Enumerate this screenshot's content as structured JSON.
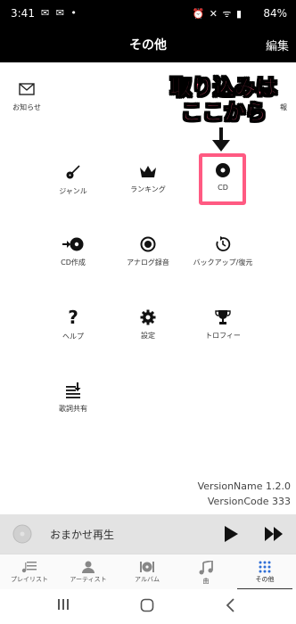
{
  "status": {
    "time": "3:41",
    "left_icons": "✉ ✉ •",
    "right_icons": "⏰ ✕ ᯤ ▮",
    "battery": "84%"
  },
  "header": {
    "title": "その他",
    "edit_label": "編集"
  },
  "notice": {
    "label": "お知らせ",
    "partial_label": "報"
  },
  "grid": {
    "genre": "ジャンル",
    "ranking": "ランキング",
    "cd": "CD",
    "cd_create": "CD作成",
    "analog_rec": "アナログ録音",
    "backup": "バックアップ/復元",
    "help": "ヘルプ",
    "settings": "設定",
    "trophy": "トロフィー",
    "lyrics_share": "歌詞共有"
  },
  "annotation": {
    "line1": "取り込みは",
    "line2": "ここから",
    "color": "#ff5a82"
  },
  "version": {
    "name": "VersionName 1.2.0",
    "code": "VersionCode 333"
  },
  "player": {
    "label": "おまかせ再生"
  },
  "tabs": [
    {
      "label": "プレイリスト"
    },
    {
      "label": "アーティスト"
    },
    {
      "label": "アルバム"
    },
    {
      "label": "曲"
    },
    {
      "label": "その他"
    }
  ]
}
